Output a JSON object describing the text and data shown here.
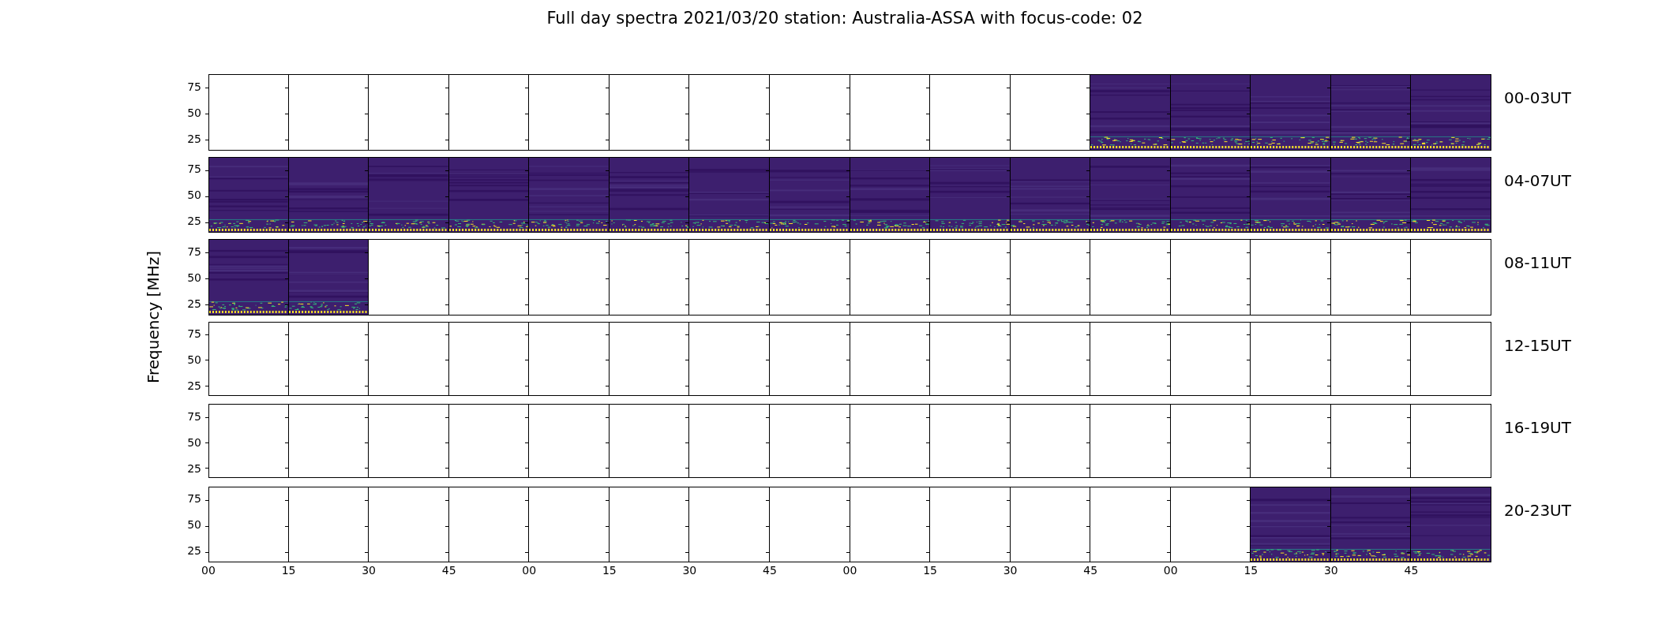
{
  "title": "Full day spectra 2021/03/20 station: Australia-ASSA with focus-code: 02",
  "ylabel": "Frequency [MHz]",
  "rows": [
    {
      "label": "00-03UT",
      "yticks": [
        "75",
        "50",
        "25"
      ],
      "panels": [
        {
          "has_data": false
        },
        {
          "has_data": false
        },
        {
          "has_data": false
        },
        {
          "has_data": false
        },
        {
          "has_data": false
        },
        {
          "has_data": false
        },
        {
          "has_data": false
        },
        {
          "has_data": false
        },
        {
          "has_data": false
        },
        {
          "has_data": false
        },
        {
          "has_data": false
        },
        {
          "has_data": true
        },
        {
          "has_data": true
        },
        {
          "has_data": true
        },
        {
          "has_data": true
        },
        {
          "has_data": true
        }
      ]
    },
    {
      "label": "04-07UT",
      "yticks": [
        "75",
        "50",
        "25"
      ],
      "panels": [
        {
          "has_data": true
        },
        {
          "has_data": true
        },
        {
          "has_data": true
        },
        {
          "has_data": true
        },
        {
          "has_data": true
        },
        {
          "has_data": true
        },
        {
          "has_data": true
        },
        {
          "has_data": true
        },
        {
          "has_data": true
        },
        {
          "has_data": true
        },
        {
          "has_data": true
        },
        {
          "has_data": true
        },
        {
          "has_data": true
        },
        {
          "has_data": true
        },
        {
          "has_data": true
        },
        {
          "has_data": true
        }
      ]
    },
    {
      "label": "08-11UT",
      "yticks": [
        "75",
        "50",
        "25"
      ],
      "panels": [
        {
          "has_data": true
        },
        {
          "has_data": true
        },
        {
          "has_data": false
        },
        {
          "has_data": false
        },
        {
          "has_data": false
        },
        {
          "has_data": false
        },
        {
          "has_data": false
        },
        {
          "has_data": false
        },
        {
          "has_data": false
        },
        {
          "has_data": false
        },
        {
          "has_data": false
        },
        {
          "has_data": false
        },
        {
          "has_data": false
        },
        {
          "has_data": false
        },
        {
          "has_data": false
        },
        {
          "has_data": false
        }
      ]
    },
    {
      "label": "12-15UT",
      "yticks": [
        "75",
        "50",
        "25"
      ],
      "panels": [
        {
          "has_data": false
        },
        {
          "has_data": false
        },
        {
          "has_data": false
        },
        {
          "has_data": false
        },
        {
          "has_data": false
        },
        {
          "has_data": false
        },
        {
          "has_data": false
        },
        {
          "has_data": false
        },
        {
          "has_data": false
        },
        {
          "has_data": false
        },
        {
          "has_data": false
        },
        {
          "has_data": false
        },
        {
          "has_data": false
        },
        {
          "has_data": false
        },
        {
          "has_data": false
        },
        {
          "has_data": false
        }
      ]
    },
    {
      "label": "16-19UT",
      "yticks": [
        "75",
        "50",
        "25"
      ],
      "panels": [
        {
          "has_data": false
        },
        {
          "has_data": false
        },
        {
          "has_data": false
        },
        {
          "has_data": false
        },
        {
          "has_data": false
        },
        {
          "has_data": false
        },
        {
          "has_data": false
        },
        {
          "has_data": false
        },
        {
          "has_data": false
        },
        {
          "has_data": false
        },
        {
          "has_data": false
        },
        {
          "has_data": false
        },
        {
          "has_data": false
        },
        {
          "has_data": false
        },
        {
          "has_data": false
        },
        {
          "has_data": false
        }
      ]
    },
    {
      "label": "20-23UT",
      "yticks": [
        "75",
        "50",
        "25"
      ],
      "panels": [
        {
          "has_data": false
        },
        {
          "has_data": false
        },
        {
          "has_data": false
        },
        {
          "has_data": false
        },
        {
          "has_data": false
        },
        {
          "has_data": false
        },
        {
          "has_data": false
        },
        {
          "has_data": false
        },
        {
          "has_data": false
        },
        {
          "has_data": false
        },
        {
          "has_data": false
        },
        {
          "has_data": false
        },
        {
          "has_data": false
        },
        {
          "has_data": true
        },
        {
          "has_data": true
        },
        {
          "has_data": true
        }
      ]
    }
  ],
  "xticks": [
    "00",
    "15",
    "30",
    "45",
    "00",
    "15",
    "30",
    "45",
    "00",
    "15",
    "30",
    "45",
    "00",
    "15",
    "30",
    "45"
  ]
}
